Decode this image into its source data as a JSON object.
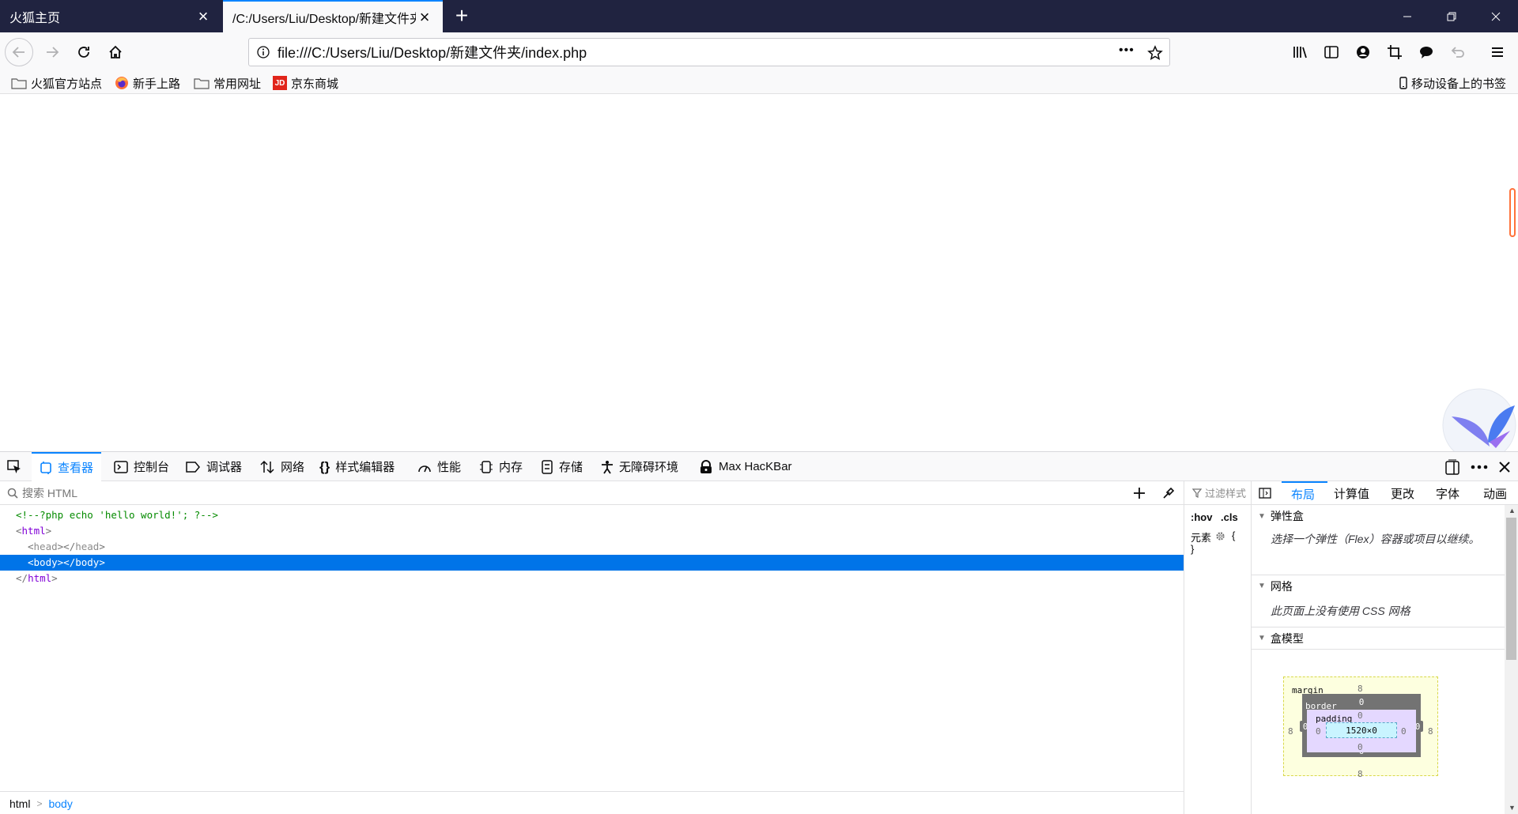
{
  "tabs": [
    {
      "title": "火狐主页",
      "close": "×"
    },
    {
      "title": "/C:/Users/Liu/Desktop/新建文件夹",
      "close": "×"
    }
  ],
  "new_tab": "+",
  "window_controls": {
    "minimize": "—",
    "restore": "❐",
    "close": "✕"
  },
  "navbar": {
    "url": "file:///C:/Users/Liu/Desktop/新建文件夹/index.php",
    "page_actions": "•••"
  },
  "bookmarks": [
    {
      "label": "火狐官方站点",
      "icon": "folder-icon"
    },
    {
      "label": "新手上路",
      "icon": "firefox-icon"
    },
    {
      "label": "常用网址",
      "icon": "folder-icon"
    },
    {
      "label": "京东商城",
      "icon": "jd-icon",
      "icon_text": "JD"
    }
  ],
  "mobile_bookmarks": "移动设备上的书签",
  "devtools": {
    "tabs": [
      {
        "label": "查看器",
        "icon": "inspector-icon"
      },
      {
        "label": "控制台",
        "icon": "console-icon"
      },
      {
        "label": "调试器",
        "icon": "debugger-icon"
      },
      {
        "label": "网络",
        "icon": "network-icon"
      },
      {
        "label": "样式编辑器",
        "icon": "style-editor-icon",
        "icon_text": "{}"
      },
      {
        "label": "性能",
        "icon": "performance-icon"
      },
      {
        "label": "内存",
        "icon": "memory-icon"
      },
      {
        "label": "存储",
        "icon": "storage-icon"
      },
      {
        "label": "无障碍环境",
        "icon": "accessibility-icon"
      },
      {
        "label": "Max HacKBar",
        "icon": "hackbar-icon"
      }
    ],
    "search_placeholder": "搜索 HTML",
    "markup": {
      "comment": "<!--?php echo 'hello world!'; ?-->",
      "html_open": "html",
      "head": "head",
      "body": "body",
      "html_close": "html",
      "lt": "<",
      "gt": ">",
      "lt_slash": "</"
    },
    "breadcrumbs": [
      "html",
      "body"
    ],
    "breadcrumb_sep": ">",
    "rules": {
      "filter_placeholder": "过滤样式",
      "hov": ":hov",
      "cls": ".cls",
      "element": "元素",
      "open_brace": "{",
      "close_brace": "}"
    },
    "side_tabs": [
      "布局",
      "计算值",
      "更改",
      "字体",
      "动画"
    ],
    "flexbox": {
      "title": "弹性盒",
      "text": "选择一个弹性（Flex）容器或项目以继续。"
    },
    "grid": {
      "title": "网格",
      "text": "此页面上没有使用 CSS 网格"
    },
    "box_model": {
      "title": "盒模型",
      "margin_label": "margin",
      "border_label": "border",
      "padding_label": "padding",
      "content_size": "1520×0",
      "margin": {
        "top": "8",
        "right": "8",
        "bottom": "8",
        "left": "8"
      },
      "border": {
        "top": "0",
        "right": "0",
        "bottom": "0",
        "left": "0"
      },
      "padding": {
        "top": "0",
        "right": "0",
        "bottom": "0",
        "left": "0"
      }
    }
  }
}
